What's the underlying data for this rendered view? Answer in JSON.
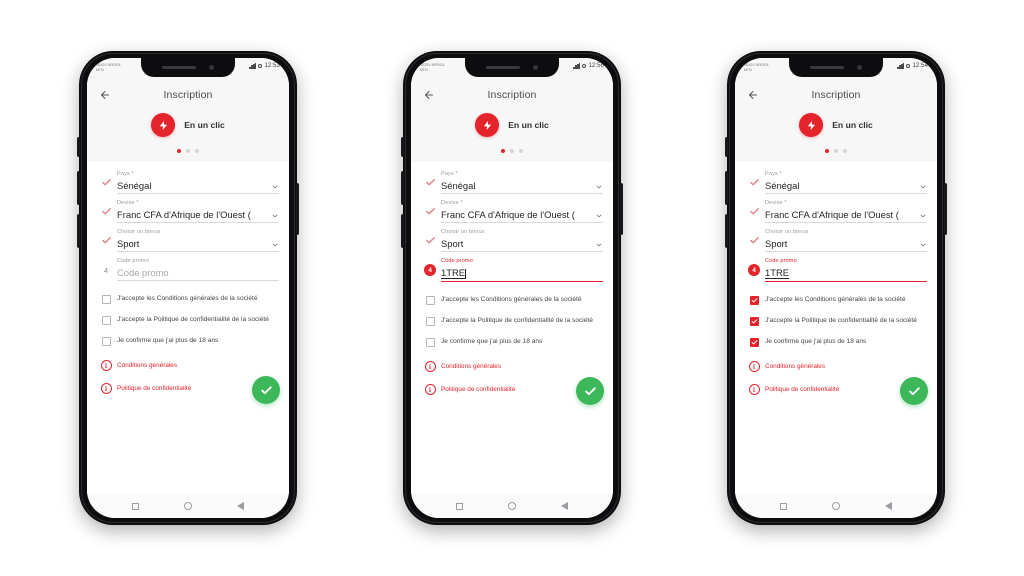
{
  "scene": {
    "description": "Three smartphone mockups showing a French registration (Inscription) form at successive steps"
  },
  "app": {
    "back_icon": "arrow-left-icon",
    "title": "Inscription",
    "brand_icon": "lightning-bolt-icon",
    "brand_label": "En un clic",
    "pager": {
      "total": 3,
      "active_index": 0
    }
  },
  "status_bar": {
    "carrier": "MOOV AFRICA\nMTN",
    "signal_icon": "signal-bars-icon",
    "network_icon": "network-dot-icon"
  },
  "fields": {
    "country": {
      "label": "Pays *",
      "value": "Sénégal",
      "chevron_icon": "chevron-down-icon"
    },
    "currency": {
      "label": "Devise *",
      "value": "Franc CFA d'Afrique de l'Ouest (",
      "chevron_icon": "chevron-down-icon"
    },
    "bonus": {
      "label": "Choisir un bonus",
      "value": "Sport",
      "chevron_icon": "chevron-down-icon"
    },
    "promo": {
      "label": "Code promo",
      "placeholder": "Code promo",
      "value": "1TRE"
    }
  },
  "consents": {
    "terms": "J'accepte les Conditions générales de la société",
    "privacy": "J'accepte la Politique de confidentialité de la société",
    "age": "Je confirme que j'ai plus de 18 ans"
  },
  "links": {
    "info_icon": "info-circle-icon",
    "glyph": "i",
    "terms": "Conditions générales",
    "privacy": "Politique de confidentialité"
  },
  "submit": {
    "icon": "check-icon",
    "label": "Valider"
  },
  "nav": {
    "recents_icon": "square-recents-icon",
    "home_icon": "circle-home-icon",
    "back_icon": "triangle-back-icon"
  },
  "colors": {
    "brand_red": "#e3242b",
    "success_green": "#3cb85b",
    "text_dark": "#25252a",
    "text_muted": "#9a9aa0",
    "frame_black": "#0d0d0f",
    "screen_bg": "#f7f7f8"
  },
  "phones": [
    {
      "id": "phone-1",
      "clock": "12:53",
      "step_markers": [
        "check",
        "check",
        "check",
        "4-plain"
      ],
      "promo_value": "",
      "promo_filled": false,
      "promo_caret": false,
      "promo_accent": false,
      "checkboxes": [
        false,
        false,
        false
      ]
    },
    {
      "id": "phone-2",
      "clock": "12:56",
      "step_markers": [
        "check",
        "check",
        "check",
        "4-badge"
      ],
      "promo_value": "1TRE",
      "promo_filled": true,
      "promo_caret": true,
      "promo_accent": true,
      "checkboxes": [
        false,
        false,
        false
      ]
    },
    {
      "id": "phone-3",
      "clock": "12:54",
      "step_markers": [
        "check",
        "check",
        "check",
        "4-badge"
      ],
      "promo_value": "1TRE",
      "promo_filled": true,
      "promo_caret": false,
      "promo_accent": true,
      "checkboxes": [
        true,
        true,
        true
      ]
    }
  ]
}
